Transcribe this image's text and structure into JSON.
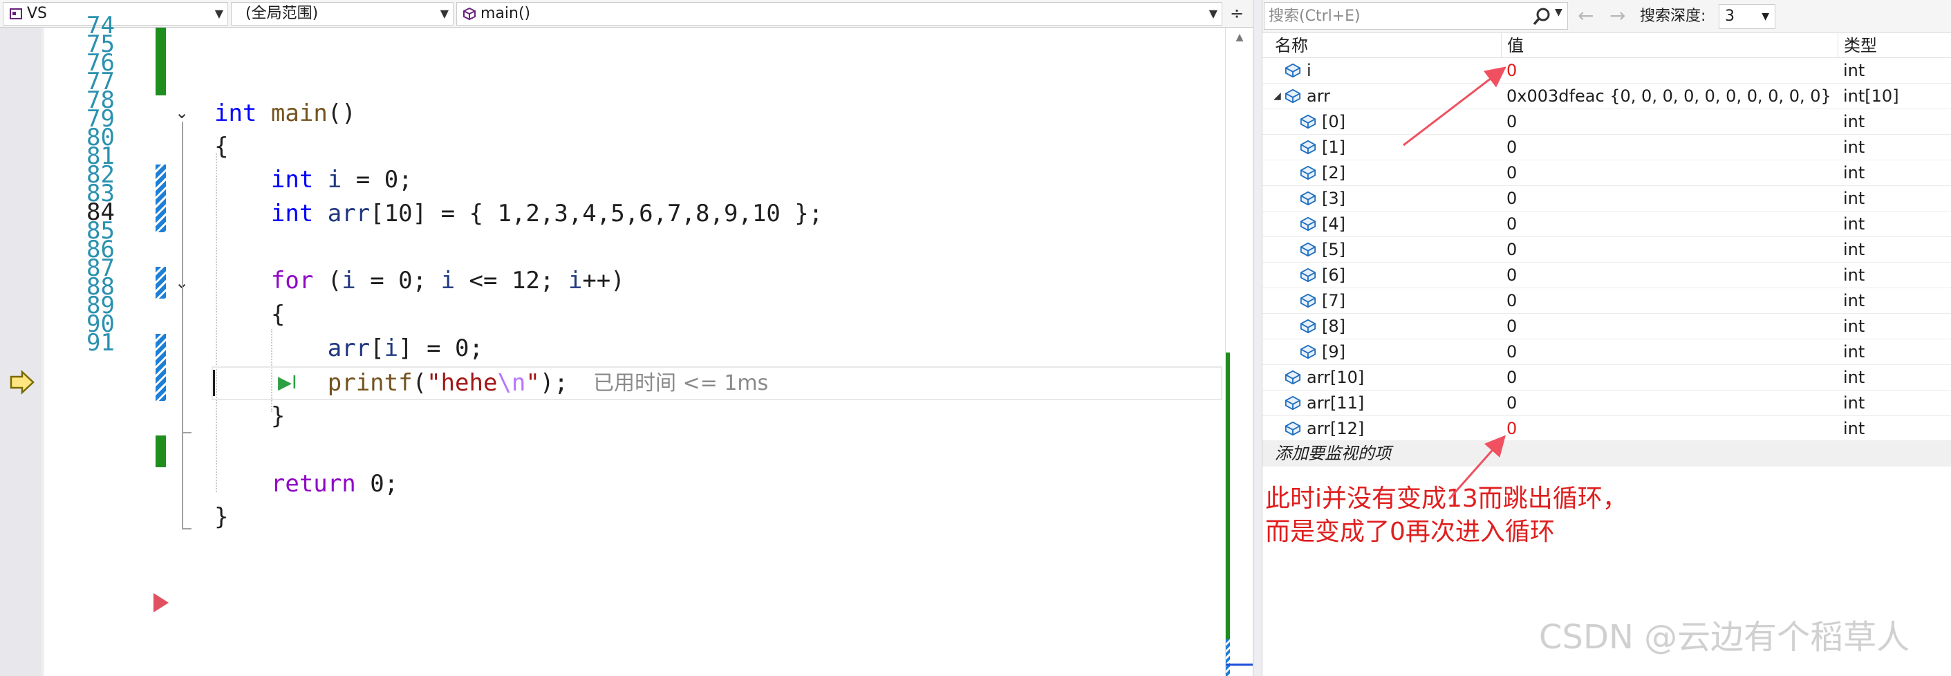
{
  "editor": {
    "nav": {
      "project": "VS",
      "scope": "(全局范围)",
      "function": "main()"
    },
    "current_line": 84,
    "performance_tip": "已用时间 <= 1ms",
    "lines": [
      {
        "no": "74"
      },
      {
        "no": "75"
      },
      {
        "no": "76"
      },
      {
        "no": "77"
      },
      {
        "no": "78"
      },
      {
        "no": "79"
      },
      {
        "no": "80"
      },
      {
        "no": "81"
      },
      {
        "no": "82"
      },
      {
        "no": "83"
      },
      {
        "no": "84"
      },
      {
        "no": "85"
      },
      {
        "no": "86"
      },
      {
        "no": "87"
      },
      {
        "no": "88"
      },
      {
        "no": "89"
      },
      {
        "no": "90"
      },
      {
        "no": "91"
      }
    ]
  },
  "watch": {
    "search_placeholder": "搜索(Ctrl+E)",
    "depth_label": "搜索深度:",
    "depth_value": "3",
    "columns": {
      "name": "名称",
      "value": "值",
      "type": "类型"
    },
    "rows": [
      {
        "name": "i",
        "value": "0",
        "type": "int",
        "changed": true
      },
      {
        "name": "arr",
        "value": "0x003dfeac {0, 0, 0, 0, 0, 0, 0, 0, 0, 0}",
        "type": "int[10]",
        "expanded": true
      },
      {
        "name": "[0]",
        "value": "0",
        "type": "int"
      },
      {
        "name": "[1]",
        "value": "0",
        "type": "int"
      },
      {
        "name": "[2]",
        "value": "0",
        "type": "int"
      },
      {
        "name": "[3]",
        "value": "0",
        "type": "int"
      },
      {
        "name": "[4]",
        "value": "0",
        "type": "int"
      },
      {
        "name": "[5]",
        "value": "0",
        "type": "int"
      },
      {
        "name": "[6]",
        "value": "0",
        "type": "int"
      },
      {
        "name": "[7]",
        "value": "0",
        "type": "int"
      },
      {
        "name": "[8]",
        "value": "0",
        "type": "int"
      },
      {
        "name": "[9]",
        "value": "0",
        "type": "int"
      },
      {
        "name": "arr[10]",
        "value": "0",
        "type": "int"
      },
      {
        "name": "arr[11]",
        "value": "0",
        "type": "int"
      },
      {
        "name": "arr[12]",
        "value": "0",
        "type": "int",
        "changed": true
      }
    ],
    "add_item": "添加要监视的项"
  },
  "annotation": {
    "line1": "此时i并没有变成13而跳出循环，",
    "line2": "而是变成了0再次进入循环"
  },
  "watermark": "CSDN @云边有个稻草人",
  "colors": {
    "keyword": "#0000ff",
    "control_keyword": "#8f08c4",
    "function": "#74531f",
    "variable": "#1f377f",
    "string": "#a31515",
    "escape": "#b776fb",
    "line_number": "#2b91af",
    "saved_change": "#1f8e1f",
    "unsaved_change": "#1d7fd6",
    "annotation": "#e01e1e"
  }
}
